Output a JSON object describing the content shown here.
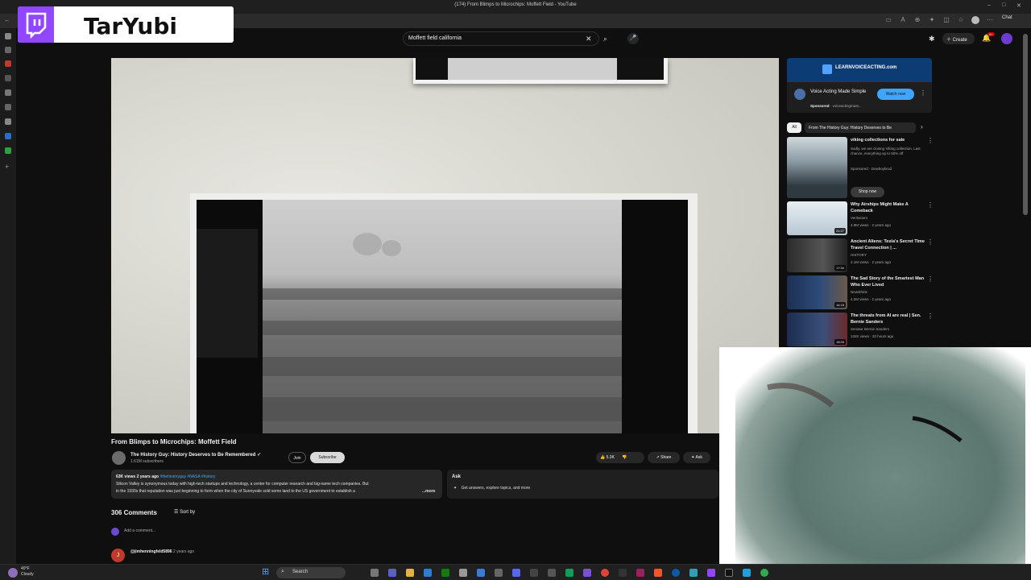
{
  "browser": {
    "tab_title": "(174) From Blimps to Microchips: Moffett Field - YouTube",
    "chat_label": "Chat",
    "window_controls": [
      "–",
      "□",
      "✕"
    ]
  },
  "overlay": {
    "streamer_name": "TarYubi",
    "brand_color": "#9146ff"
  },
  "youtube": {
    "search_query": "Moffett field california",
    "create_label": "Create",
    "notification_count": "9+"
  },
  "video": {
    "title": "From Blimps to Microchips: Moffett Field",
    "channel_name": "The History Guy: History Deserves to Be Remembered",
    "subscribers": "1.61M subscribers",
    "join_label": "Join",
    "subscribe_label": "Subscribe",
    "likes": "5.3K",
    "share_label": "Share",
    "ask_label": "Ask",
    "description": {
      "views_date": "63K views  2 years ago",
      "tags": "#thehistoryguy #NASA #history",
      "line1": "Silicon Valley is synonymous today with high-tech startups and technology, a center for computer research and big-name tech companies. But",
      "line2": "in the 1930s that reputation was just beginning to form when the city of Sunnyvale sold some land to the US government to establish a",
      "more": "...more"
    },
    "ask_panel": {
      "heading": "Ask",
      "prompt": "Get answers, explore topics, and more"
    }
  },
  "comments": {
    "count": "306 Comments",
    "sort_label": "Sort by",
    "add_placeholder": "Add a comment...",
    "first_user": "@jimhenningfeld5896",
    "first_time": "2 years ago",
    "first_avatar": "J"
  },
  "sidebar": {
    "ad_banner": "LEARNVOICEACTING.com",
    "ad_title": "Voice Acting Made Simple",
    "ad_sponsored": "Sponsored",
    "ad_domain": "voiceactingmast...",
    "ad_button": "Watch now",
    "chip_all": "All",
    "chip_channel": "From The History Guy: History Deserves to Be",
    "recommendations": [
      {
        "title": "viking collections for sale",
        "channel": "Sadly, we are closing Viking collection. Last chance, everything up to 50% off",
        "meta": "Sponsored · Dowboybrod",
        "button": "Shop now",
        "duration": ""
      },
      {
        "title": "Why Airships Might Make A Comeback",
        "channel": "Veritasium",
        "meta": "4.9M views · 2 years ago",
        "duration": "21:27"
      },
      {
        "title": "Ancient Aliens: Tesla's Secret Time Travel Connection | ...",
        "channel": "HISTORY",
        "meta": "2.1M views · 2 years ago",
        "duration": "17:34"
      },
      {
        "title": "The Sad Story of the Smartest Man Who Ever Lived",
        "channel": "Newsthink",
        "meta": "4.2M views · 2 years ago",
        "duration": "14:15"
      },
      {
        "title": "The threats from AI are real | Sen. Bernie Sanders",
        "channel": "Senator Bernie Sanders",
        "meta": "132K views · 20 hours ago",
        "duration": "15:03"
      }
    ]
  },
  "taskbar": {
    "temp": "40°F",
    "condition": "Cloudy",
    "search_label": "Search"
  }
}
